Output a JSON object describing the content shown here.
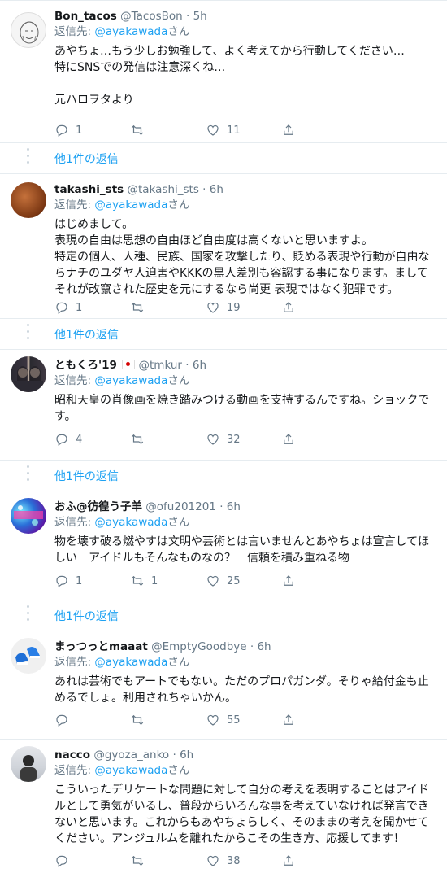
{
  "reply_prefix": "返信先: ",
  "reply_suffix": "さん",
  "thread_link_label": "他1件の返信",
  "colors": {
    "link": "#1da1f2",
    "muted": "#657786",
    "border": "#e6ecf0"
  },
  "tweets": [
    {
      "name": "Bon_tacos",
      "handle": "@TacosBon",
      "time": "5h",
      "reply_to": "@ayakawada",
      "text": "あやちょ…もう少しお勉強して、よく考えてから行動してください…\n特にSNSでの発信は注意深くね…\n\n元ハロヲタより",
      "replies": "1",
      "retweets": "",
      "likes": "11",
      "avatar_icon": "sketch-face-avatar"
    },
    {
      "name": "takashi_sts",
      "handle": "@takashi_sts",
      "time": "6h",
      "reply_to": "@ayakawada",
      "text": "はじめまして。\n表現の自由は思想の自由ほど自由度は高くないと思いますよ。\n特定の個人、人種、民族、国家を攻撃したり、貶める表現や行動が自由ならナチのユダヤ人迫害やKKKの黒人差別も容認する事になります。ましてそれが改竄された歴史を元にするなら尚更 表現ではなく犯罪です。",
      "replies": "1",
      "retweets": "",
      "likes": "19",
      "avatar_icon": "brown-object-avatar"
    },
    {
      "name": "ともくろ'19",
      "handle": "@tmkur",
      "time": "6h",
      "reply_to": "@ayakawada",
      "text": "昭和天皇の肖像画を焼き踏みつける動画を支持するんですね。ショックです。",
      "replies": "4",
      "retweets": "",
      "likes": "32",
      "avatar_icon": "two-people-photo-avatar"
    },
    {
      "name": "おふ@彷徨う子羊",
      "handle": "@ofu201201",
      "time": "6h",
      "reply_to": "@ayakawada",
      "text": "物を壊す破る燃やすは文明や芸術とは言いませんとあやちょは宣言してほしい　アイドルもそんなものなの？　信頼を積み重ねる物",
      "replies": "1",
      "retweets": "1",
      "likes": "25",
      "avatar_icon": "stage-lights-avatar"
    },
    {
      "name": "まっつっとmaaat",
      "handle": "@EmptyGoodbye",
      "time": "6h",
      "reply_to": "@ayakawada",
      "text": "あれは芸術でもアートでもない。ただのプロパガンダ。そりゃ給付金も止めるでしょ。利用されちゃいかん。",
      "replies": "",
      "retweets": "",
      "likes": "55",
      "avatar_icon": "blue-shoes-avatar"
    },
    {
      "name": "nacco",
      "handle": "@gyoza_anko",
      "time": "6h",
      "reply_to": "@ayakawada",
      "text": "こういったデリケートな問題に対して自分の考えを表明することはアイドルとして勇気がいるし、普段からいろんな事を考えていなければ発言できないと思います。これからもあやちょらしく、そのままの考えを聞かせてください。アンジュルムを離れたからこその生き方、応援してます！",
      "replies": "",
      "retweets": "",
      "likes": "38",
      "avatar_icon": "person-photo-avatar"
    }
  ]
}
